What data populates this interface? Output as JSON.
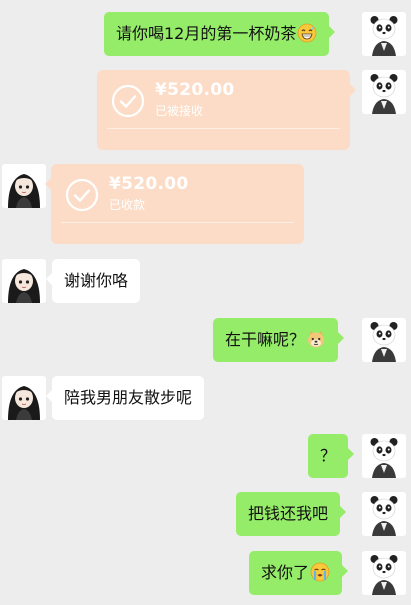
{
  "messages": [
    {
      "side": "out",
      "type": "text",
      "text": "请你喝12月的第一杯奶茶",
      "emoji": "grinning-sweat-emoji"
    },
    {
      "side": "out",
      "type": "transfer",
      "amount": "¥520.00",
      "status": "已被接收"
    },
    {
      "side": "in",
      "type": "transfer",
      "amount": "¥520.00",
      "status": "已收款"
    },
    {
      "side": "in",
      "type": "text",
      "text": "谢谢你咯"
    },
    {
      "side": "out",
      "type": "text",
      "text": "在干嘛呢？",
      "emoji": "doge-emoji"
    },
    {
      "side": "in",
      "type": "text",
      "text": "陪我男朋友散步呢"
    },
    {
      "side": "out",
      "type": "text",
      "text": "？"
    },
    {
      "side": "out",
      "type": "text",
      "text": "把钱还我吧"
    },
    {
      "side": "out",
      "type": "text",
      "text": "求你了",
      "emoji": "crying-face-emoji"
    }
  ],
  "colors": {
    "background": "#ededed",
    "outgoing_bubble": "#95ec69",
    "incoming_bubble": "#ffffff",
    "transfer_card": "#fcdcc6"
  }
}
